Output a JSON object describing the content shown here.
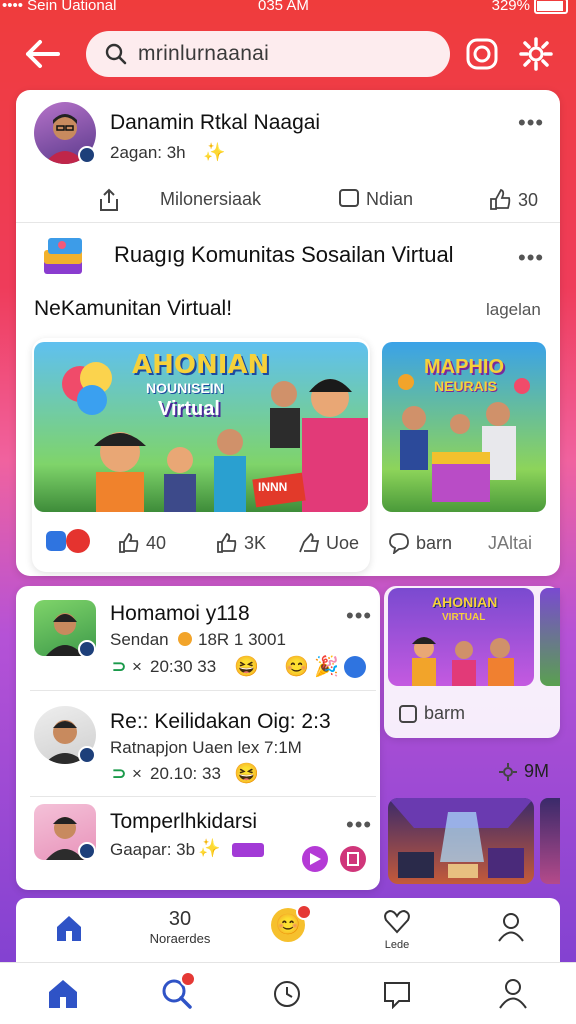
{
  "status": {
    "carrier": "•••• Sein Uational",
    "time": "035 AM",
    "battery": "329%"
  },
  "header": {
    "search_placeholder": "mrinlurnaanai"
  },
  "post1": {
    "author": "Danamin Rtkal Naagai",
    "meta": "2agan: 3h",
    "share_label": "Milonersiaak",
    "comment_label": "Ndian",
    "like_count": "30"
  },
  "community": {
    "title": "Ruagıg Komunitas Sosailan Virtual",
    "subtitle": "NeKamunitan Virtual!",
    "side_link": "lagelan",
    "banner_title": "AHONIAN",
    "banner_sub": "NOUNISEIN",
    "banner_word": "Virtual",
    "banner_sign": "INNN",
    "likes": "40",
    "thumbs": "3K",
    "shares": "Uoe",
    "side_banner_title": "MAPHIO",
    "side_banner_sub": "NEURAIS",
    "side_comment": "barn",
    "side_label": "JAltai"
  },
  "feed": [
    {
      "name": "Homamoi y118",
      "line1": "Sendan",
      "line1b": "18R 1  3001",
      "line2": "20:30 33"
    },
    {
      "name": "Re:: Keilidakan Oig:  2:3",
      "line1": "Ratnapjon Uaen lex 7:1M",
      "line2": "20.10: 33"
    },
    {
      "name": "Tomperlhkidarsi",
      "line1": "Gaapar: 3b"
    }
  ],
  "side_feed": {
    "banner_title": "AHONIAN",
    "banner_sub": "VIRTUAL",
    "button_label": "barm",
    "count": "9M"
  },
  "nav_top": {
    "count": "30",
    "label1": "Noraerdes",
    "label2": "Lede"
  },
  "colors": {
    "accent": "#ef3c3c",
    "nav_blue": "#2f53c6",
    "purple": "#a23ad6",
    "red_badge": "#e53935"
  }
}
